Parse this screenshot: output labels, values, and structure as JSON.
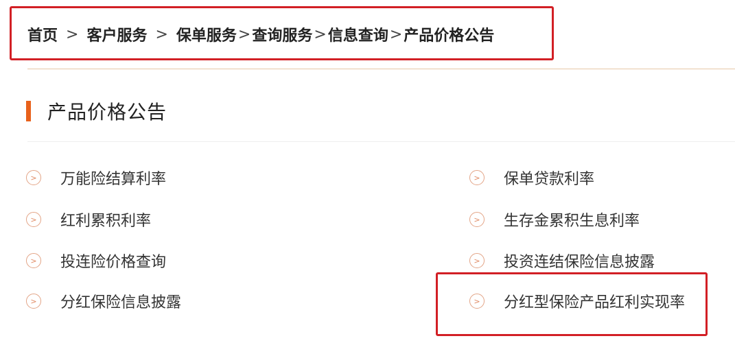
{
  "breadcrumb": {
    "home": "首页",
    "sep": ">",
    "items": [
      "客户服务",
      "保单服务",
      "查询服务",
      "信息查询"
    ],
    "current": "产品价格公告"
  },
  "section": {
    "title": "产品价格公告",
    "accent_color": "#e8611b"
  },
  "links": {
    "left": [
      "万能险结算利率",
      "红利累积利率",
      "投连险价格查询",
      "分红保险信息披露"
    ],
    "right": [
      "保单贷款利率",
      "生存金累积生息利率",
      "投资连结保险信息披露",
      "分红型保险产品红利实现率"
    ]
  },
  "icons": {
    "link_arrow": "circle-arrow-right-icon"
  },
  "colors": {
    "highlight_box": "#d21f25",
    "icon": "#e3a486"
  }
}
